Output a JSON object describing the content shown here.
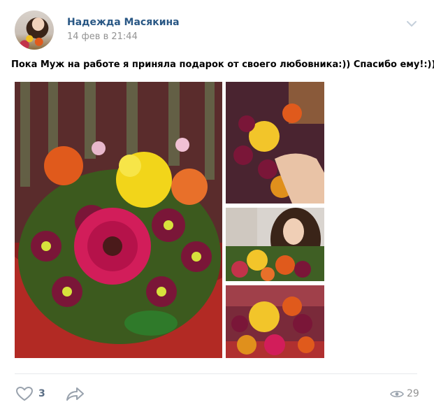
{
  "post": {
    "author_name": "Надежда Масякина",
    "date": "14 фев в 21:44",
    "text": "Пока Муж на работе я приняла подарок от своего любовника:)) Спасибо ему!:))"
  },
  "photos": [
    {
      "subject": "flower-bouquet"
    },
    {
      "subject": "hand-with-bouquet"
    },
    {
      "subject": "woman-with-bouquet"
    },
    {
      "subject": "bouquet-on-table"
    }
  ],
  "actions": {
    "likes": "3",
    "views": "29"
  },
  "icons": {
    "menu": "chevron-down-icon",
    "like": "heart-icon",
    "share": "share-arrow-icon",
    "views": "eye-icon"
  },
  "colors": {
    "author_link": "#2a5885",
    "meta_text": "#939393",
    "action_icon": "#99a2ad",
    "count_text": "#5b6e85"
  }
}
